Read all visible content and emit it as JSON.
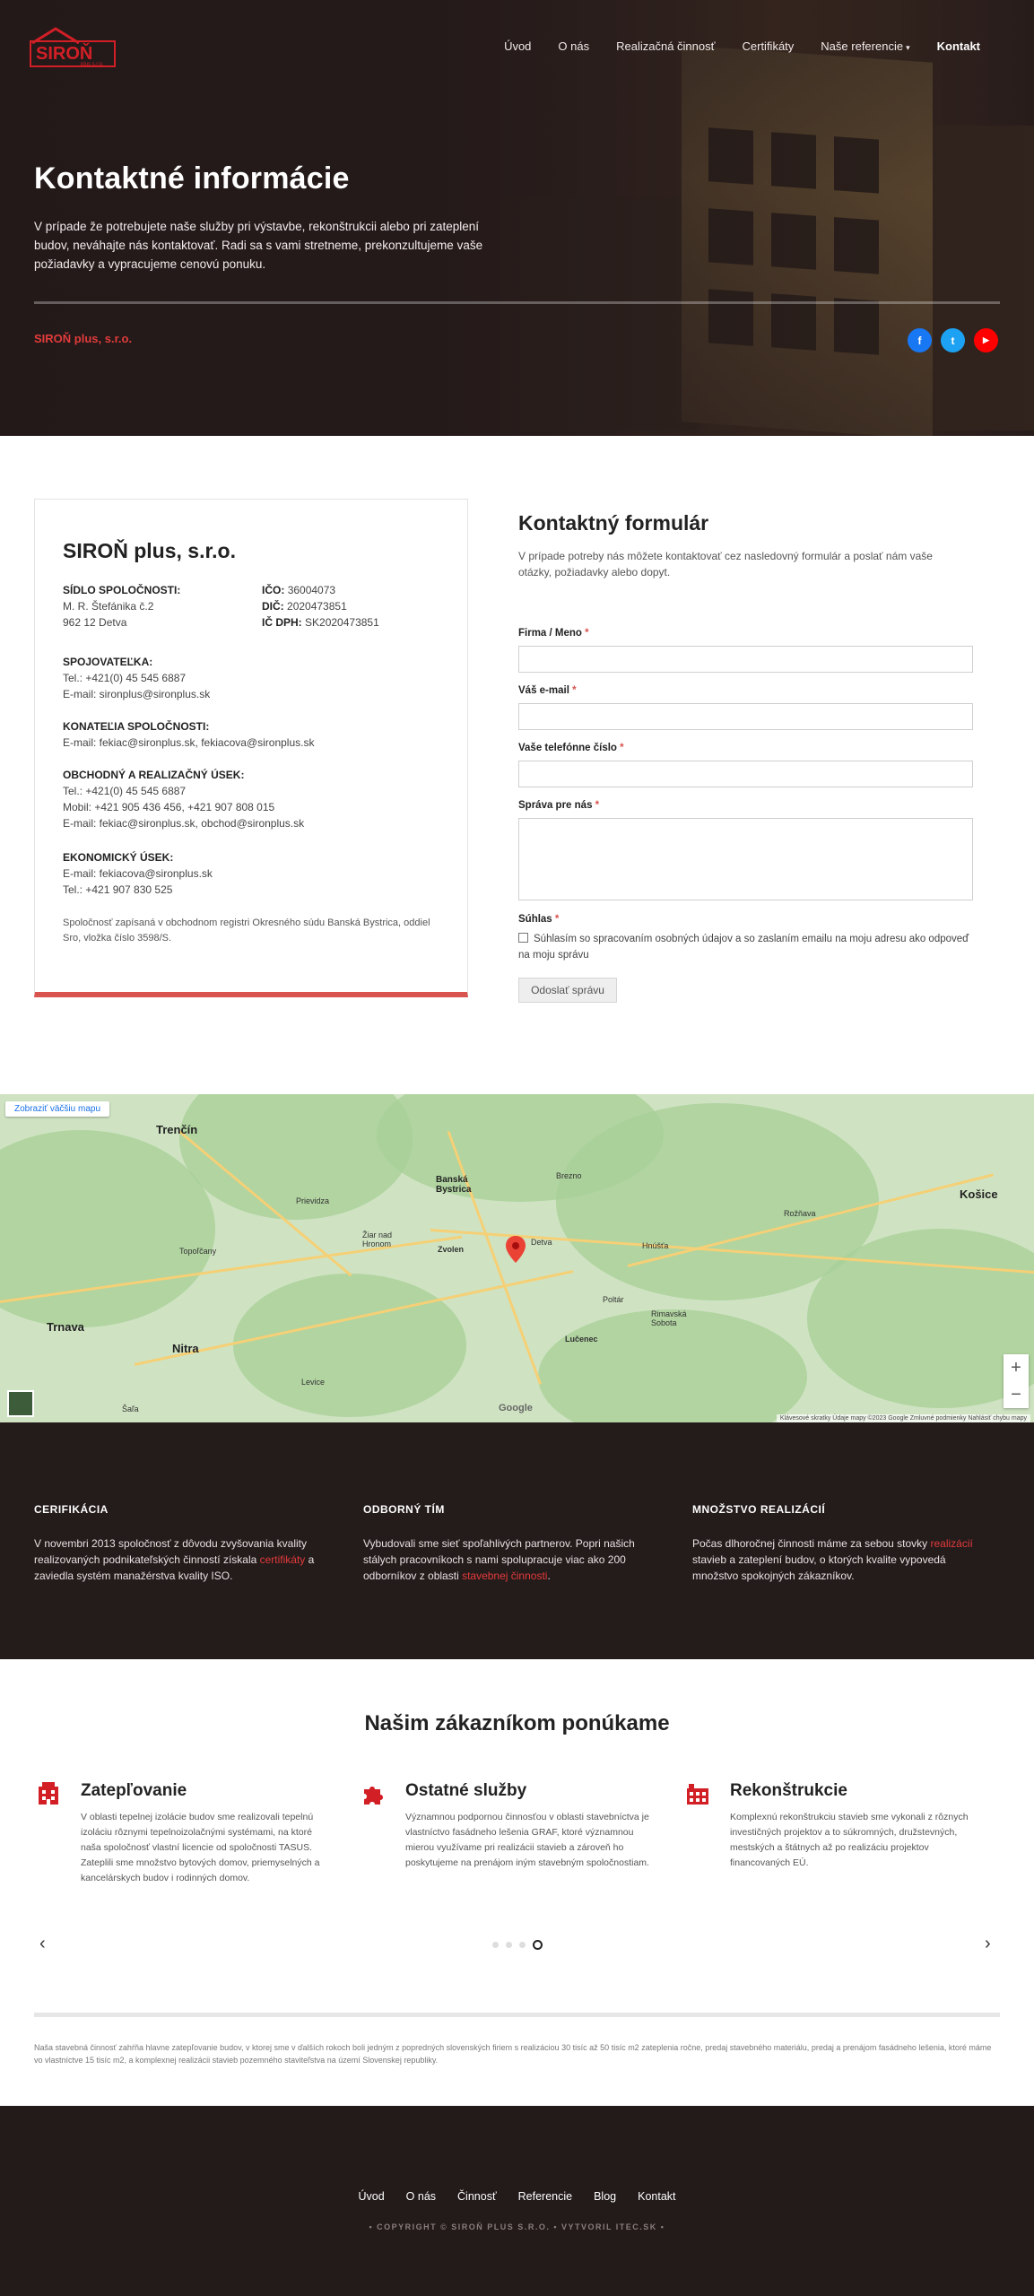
{
  "nav": {
    "logo_text": "SIROŇ",
    "logo_sub": "plus s.r.o.",
    "items": [
      {
        "label": "Úvod"
      },
      {
        "label": "O nás"
      },
      {
        "label": "Realizačná činnosť"
      },
      {
        "label": "Certifikáty"
      },
      {
        "label": "Naše referencie"
      },
      {
        "label": "Kontakt"
      }
    ]
  },
  "hero": {
    "title": "Kontaktné informácie",
    "lead": "V prípade že potrebujete naše služby pri výstavbe, rekonštrukcii alebo pri zateplení budov, neváhajte nás kontaktovať. Radi sa s vami stretneme, prekonzultujeme vaše požiadavky a vypracujeme cenovú ponuku.",
    "company": "SIROŇ plus, s.r.o.",
    "socials": [
      {
        "icon": "facebook-icon",
        "glyph": "f",
        "color": "#1877f2"
      },
      {
        "icon": "twitter-icon",
        "glyph": "t",
        "color": "#1da1f2"
      },
      {
        "icon": "youtube-icon",
        "glyph": "▶",
        "color": "#ff0000"
      }
    ]
  },
  "card": {
    "title": "SIROŇ plus, s.r.o.",
    "seat_label": "SÍDLO SPOLOČNOSTI:",
    "seat_line1": "M. R. Štefánika č.2",
    "seat_line2": "962 12 Detva",
    "ico_label": "IČO:",
    "ico": "36004073",
    "dic_label": "DIČ:",
    "dic": "2020473851",
    "icdph_label": "IČ DPH:",
    "icdph": "SK2020473851",
    "conn_label": "SPOJOVATEĽKA:",
    "conn_tel": "Tel.: +421(0) 45 545 6887",
    "conn_mail": "E-mail: sironplus@sironplus.sk",
    "exec_label": "KONATEĽIA SPOLOČNOSTI:",
    "exec_mail": "E-mail: fekiac@sironplus.sk, fekiacova@sironplus.sk",
    "trade_label": "OBCHODNÝ A REALIZAČNÝ ÚSEK:",
    "trade_tel": "Tel.: +421(0) 45 545 6887",
    "trade_mob": "Mobil: +421 905 436 456, +421 907 808 015",
    "trade_mail": "E-mail: fekiac@sironplus.sk, obchod@sironplus.sk",
    "econ_label": "EKONOMICKÝ ÚSEK:",
    "econ_mail": "E-mail: fekiacova@sironplus.sk",
    "econ_tel": "Tel.: +421 907 830 525",
    "note": "Spoločnosť zapísaná v obchodnom registri Okresného súdu Banská Bystrica, oddiel Sro, vložka číslo 3598/S."
  },
  "form": {
    "title": "Kontaktný formulár",
    "intro": "V prípade potreby nás môžete kontaktovať cez nasledovný formulár a poslať nám vaše otázky, požiadavky alebo dopyt.",
    "name_label": "Firma / Meno",
    "email_label": "Váš e-mail",
    "phone_label": "Vaše telefónne číslo",
    "message_label": "Správa pre nás",
    "consent_label": "Súhlas",
    "consent_text": "Súhlasím so spracovaním osobných údajov a so zaslaním emailu na moju adresu ako odpoveď na moju správu",
    "submit": "Odoslať správu",
    "required_mark": "*"
  },
  "map": {
    "view_larger": "Zobraziť väčšiu mapu",
    "zoom_in": "+",
    "zoom_out": "−",
    "google": "Google",
    "footer": "Klávesové skratky   Údaje mapy ©2023 Google   Zmluvné podmienky   Nahlásiť chybu mapy",
    "towns": [
      {
        "name": "Trenčín"
      },
      {
        "name": "Banská Bystrica"
      },
      {
        "name": "Nitra"
      },
      {
        "name": "Trnava"
      },
      {
        "name": "Zvolen"
      },
      {
        "name": "Lučenec"
      },
      {
        "name": "Košice"
      },
      {
        "name": "Rimavská Sobota"
      },
      {
        "name": "Prievidza"
      },
      {
        "name": "Žiar nad Hronom"
      },
      {
        "name": "Levice"
      },
      {
        "name": "Detva"
      },
      {
        "name": "Poltár"
      },
      {
        "name": "Rožňava"
      },
      {
        "name": "Brezno"
      },
      {
        "name": "Hnúšťa"
      },
      {
        "name": "Topoľčany"
      },
      {
        "name": "Šaľa"
      }
    ]
  },
  "features": [
    {
      "title": "CERIFIKÁCIA",
      "text_before": "V novembri 2013 spoločnosť z dôvodu zvyšovania kvality realizovaných podnikateľských činností získala ",
      "link": "certifikáty",
      "text_after": " a zaviedla systém manažérstva kvality ISO."
    },
    {
      "title": "ODBORNÝ TÍM",
      "text_before": "Vybudovali sme sieť spoľahlivých partnerov. Popri našich stálych pracovníkoch s nami spolupracuje viac ako 200 odborníkov z oblasti ",
      "link": "stavebnej činnosti",
      "text_after": "."
    },
    {
      "title": "MNOŽSTVO REALIZÁCIÍ",
      "text_before": "Počas dlhoročnej činnosti máme za sebou stovky ",
      "link": "realizácií",
      "text_after": " stavieb a zateplení budov, o ktorých kvalite vypovedá množstvo spokojných zákazníkov."
    }
  ],
  "services": {
    "title": "Našim zákazníkom ponúkame",
    "items": [
      {
        "icon": "building-icon",
        "title": "Zatepľovanie",
        "text": "V oblasti tepelnej izolácie budov sme realizovali tepelnú izoláciu rôznymi tepelnoizolačnými systémami, na ktoré naša spoločnosť vlastní licencie od spoločnosti TASUS. Zateplili sme množstvo bytových domov, priemyselných a kancelárskych budov i rodinných domov."
      },
      {
        "icon": "puzzle-icon",
        "title": "Ostatné služby",
        "text": "Významnou podpornou činnosťou v oblasti stavebníctva je vlastníctvo fasádneho lešenia GRAF, ktoré významnou mierou využívame pri realizácii stavieb a zároveň ho poskytujeme na prenájom iným stavebným spoločnostiam."
      },
      {
        "icon": "industry-icon",
        "title": "Rekonštrukcie",
        "text": "Komplexnú rekonštrukciu stavieb sme vykonali z rôznych investičných projektov a to súkromných, družstevných, mestských a štátnych až po realizáciu projektov financovaných EÚ."
      }
    ],
    "prev": "‹",
    "next": "›",
    "slides": 4,
    "active_slide": 4
  },
  "disclaimer": "Naša stavebná činnosť zahŕňa hlavne zatepľovanie budov, v ktorej sme v ďalších rokoch boli jedným z popredných slovenských firiem s realizáciou 30 tisíc až 50 tisíc m2 zateplenia ročne, predaj stavebného materiálu, predaj a prenájom fasádneho lešenia, ktoré máme vo vlastníctve 15 tisíc m2, a komplexnej realizácii stavieb pozemného staviteľstva na území Slovenskej republiky.",
  "footer": {
    "links": [
      {
        "label": "Úvod"
      },
      {
        "label": "O nás"
      },
      {
        "label": "Činnosť"
      },
      {
        "label": "Referencie"
      },
      {
        "label": "Blog"
      },
      {
        "label": "Kontakt"
      }
    ],
    "copyright": "• COPYRIGHT © SIROŇ PLUS S.R.O. • VYTVORIL ITEC.SK •"
  },
  "colors": {
    "accent": "#d9534f",
    "link_red": "#e23b3b",
    "dark_bg": "#241b1b"
  }
}
